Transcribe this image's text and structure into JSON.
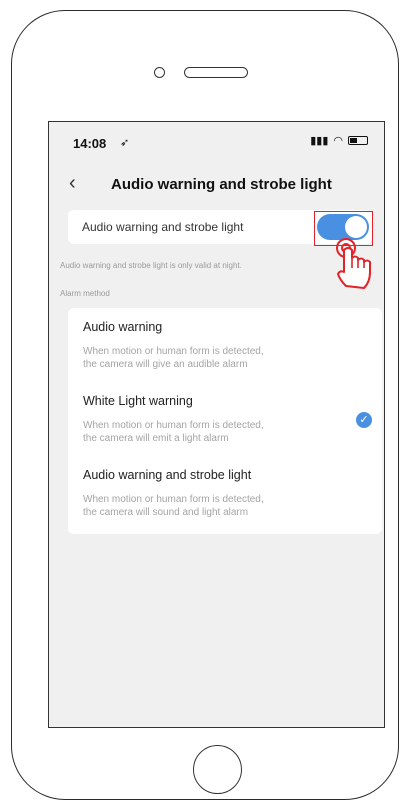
{
  "status_bar": {
    "time": "14:08",
    "location_icon": "location-arrow-icon"
  },
  "nav": {
    "back_icon": "chevron-left-icon",
    "title": "Audio warning and strobe light"
  },
  "toggle": {
    "label": "Audio warning and strobe light",
    "state": "on",
    "accent": "#4a90e2",
    "highlight": "#e2232a"
  },
  "hint": "Audio warning and strobe light is only valid at night.",
  "section_label": "Alarm method",
  "options": [
    {
      "title": "Audio warning",
      "desc1": "When motion or human form is detected,",
      "desc2": "the camera will give an audible alarm",
      "selected": false
    },
    {
      "title": "White Light warning",
      "desc1": "When motion or human form is detected,",
      "desc2": "the camera will emit a light alarm",
      "selected": true
    },
    {
      "title": "Audio warning and strobe light",
      "desc1": "When motion or human form is detected,",
      "desc2": "the camera will sound and light alarm",
      "selected": false
    }
  ]
}
